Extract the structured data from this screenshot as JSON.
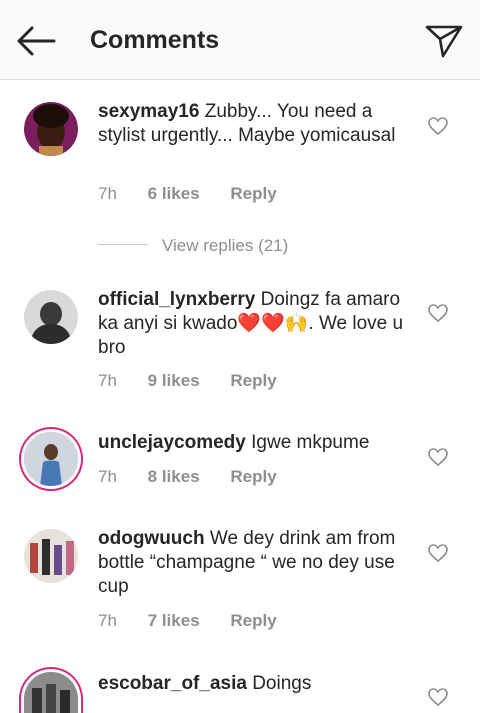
{
  "header": {
    "title": "Comments",
    "back_icon": "arrow-left-icon",
    "send_icon": "paper-plane-icon"
  },
  "comments": [
    {
      "user": "sexymay16",
      "text": "Zubby... You need a stylist urgently... Maybe yomicausal",
      "time": "7h",
      "likes": "6 likes",
      "reply": "Reply"
    },
    {
      "user": "official_lynxberry",
      "text_before": "Doingz fa amaro ka anyi si kwado",
      "emojis": "❤️❤️🙌",
      "text_after": ". We love u bro",
      "time": "7h",
      "likes": "9 likes",
      "reply": "Reply"
    },
    {
      "user": "unclejaycomedy",
      "text": "Igwe mkpume",
      "time": "7h",
      "likes": "8 likes",
      "reply": "Reply"
    },
    {
      "user": "odogwuuch",
      "text": "We dey drink am from bottle “champagne “ we no dey use cup",
      "time": "7h",
      "likes": "7 likes",
      "reply": "Reply"
    },
    {
      "user": "escobar_of_asia",
      "text": "Doings"
    }
  ],
  "view_replies": "View replies (21)",
  "colors": {
    "ring": "#d62976",
    "meta": "#8e8e8e",
    "text": "#262626"
  }
}
